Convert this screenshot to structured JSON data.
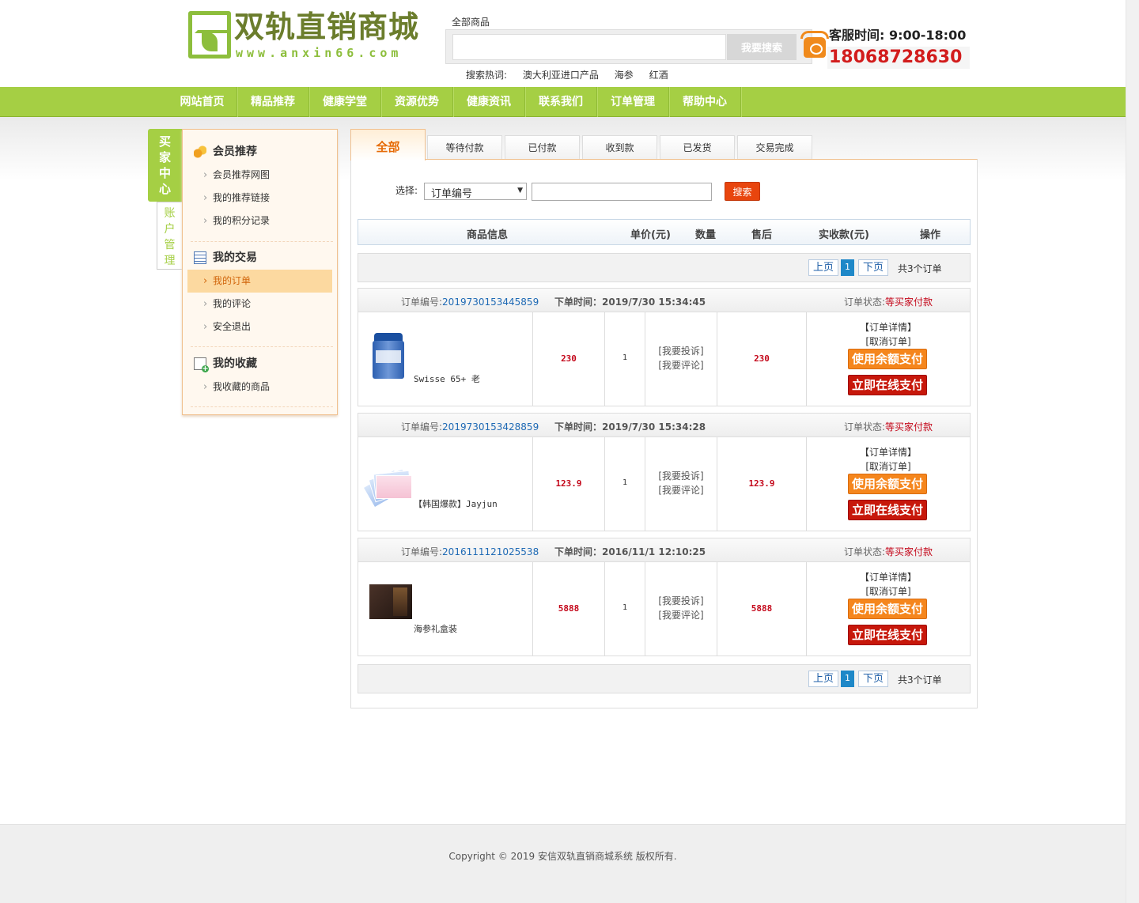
{
  "header": {
    "logo_title": "双轨直销商城",
    "logo_url": "www.anxin66.com",
    "search_category": "全部商品",
    "search_placeholder": "",
    "search_button": "我要搜索",
    "hot_label": "搜索热词:",
    "hot_words": [
      "澳大利亚进口产品",
      "海参",
      "红酒"
    ],
    "service_time": "客服时间: 9:00-18:00",
    "service_phone": "18068728630"
  },
  "nav": [
    "网站首页",
    "精品推荐",
    "健康学堂",
    "资源优势",
    "健康资讯",
    "联系我们",
    "订单管理",
    "帮助中心"
  ],
  "sidebar": {
    "tab_buyer": [
      "买",
      "家",
      "中",
      "心"
    ],
    "tab_account": [
      "账",
      "户",
      "管",
      "理"
    ],
    "sections": [
      {
        "title": "会员推荐",
        "icon": "coins-icon",
        "items": [
          "会员推荐网图",
          "我的推荐链接",
          "我的积分记录"
        ]
      },
      {
        "title": "我的交易",
        "icon": "list-icon",
        "items": [
          "我的订单",
          "我的评论",
          "安全退出"
        ],
        "active": "我的订单"
      },
      {
        "title": "我的收藏",
        "icon": "favorite-add-icon",
        "items": [
          "我收藏的商品"
        ]
      }
    ]
  },
  "tabs": [
    "全部",
    "等待付款",
    "已付款",
    "收到款",
    "已发货",
    "交易完成"
  ],
  "filter": {
    "label": "选择:",
    "select_value": "订单编号",
    "input_value": "",
    "button": "搜索"
  },
  "table_headers": [
    "商品信息",
    "单价(元)",
    "数量",
    "售后",
    "实收款(元)",
    "操作"
  ],
  "pager": {
    "prev": "上页",
    "current": "1",
    "next": "下页",
    "total": "共3个订单"
  },
  "order_labels": {
    "no_label": "订单编号:",
    "status_label": "订单状态:",
    "complain": "[我要投诉]",
    "review": "[我要评论]",
    "detail": "【订单详情】",
    "cancel": "[取消订单]",
    "pay_balance": "使用余额支付",
    "pay_online": "立即在线支付"
  },
  "orders": [
    {
      "no": "2019730153445859",
      "time": "下单时间：2019/7/30 15:34:45",
      "status": "等买家付款",
      "product": "Swisse 65+ 老",
      "price": "230",
      "qty": "1",
      "paid": "230"
    },
    {
      "no": "2019730153428859",
      "time": "下单时间：2019/7/30 15:34:28",
      "status": "等买家付款",
      "product": "【韩国爆款】Jayjun",
      "price": "123.9",
      "qty": "1",
      "paid": "123.9"
    },
    {
      "no": "2016111121025538",
      "time": "下单时间：2016/11/1 12:10:25",
      "status": "等买家付款",
      "product": "海参礼盒装",
      "price": "5888",
      "qty": "1",
      "paid": "5888"
    }
  ],
  "footer": {
    "copyright": "Copyright © 2019 安信双轨直销商城系统 版权所有."
  }
}
